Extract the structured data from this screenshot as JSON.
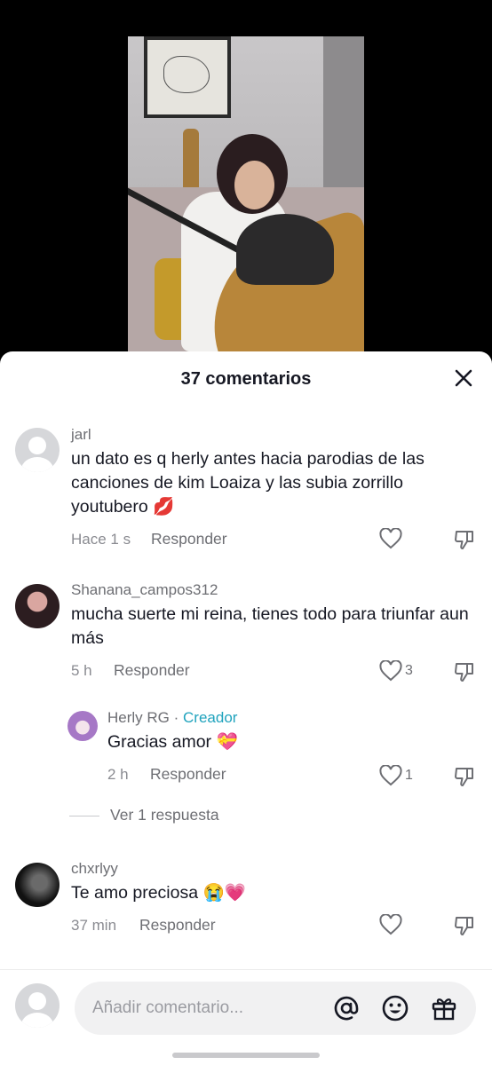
{
  "header": {
    "title": "37 comentarios",
    "close_icon": "close-icon"
  },
  "comments": [
    {
      "username": "jarl",
      "text": "un dato es q herly antes hacia parodias de las canciones de kim Loaiza y las subia zorrillo youtubero 💋",
      "time": "Hace 1 s",
      "reply_label": "Responder",
      "likes": ""
    },
    {
      "username": "Shanana_campos312",
      "text": "mucha suerte mi reina, tienes todo para triunfar aun más",
      "time": "5 h",
      "reply_label": "Responder",
      "likes": "3"
    },
    {
      "username": "Herly RG",
      "separator": " · ",
      "creator_label": "Creador",
      "text": "Gracias amor 💝",
      "time": "2 h",
      "reply_label": "Responder",
      "likes": "1"
    },
    {
      "username": "chxrlyy",
      "text": "Te amo preciosa 😭💗",
      "time": "37 min",
      "reply_label": "Responder",
      "likes": ""
    }
  ],
  "view_replies": "Ver 1 respuesta",
  "composer": {
    "placeholder": "Añadir comentario...",
    "icons": [
      "at-icon",
      "emoji-icon",
      "gift-icon"
    ]
  },
  "colors": {
    "creator": "#20a3bd",
    "text": "#161823",
    "muted": "#6d6e73"
  }
}
